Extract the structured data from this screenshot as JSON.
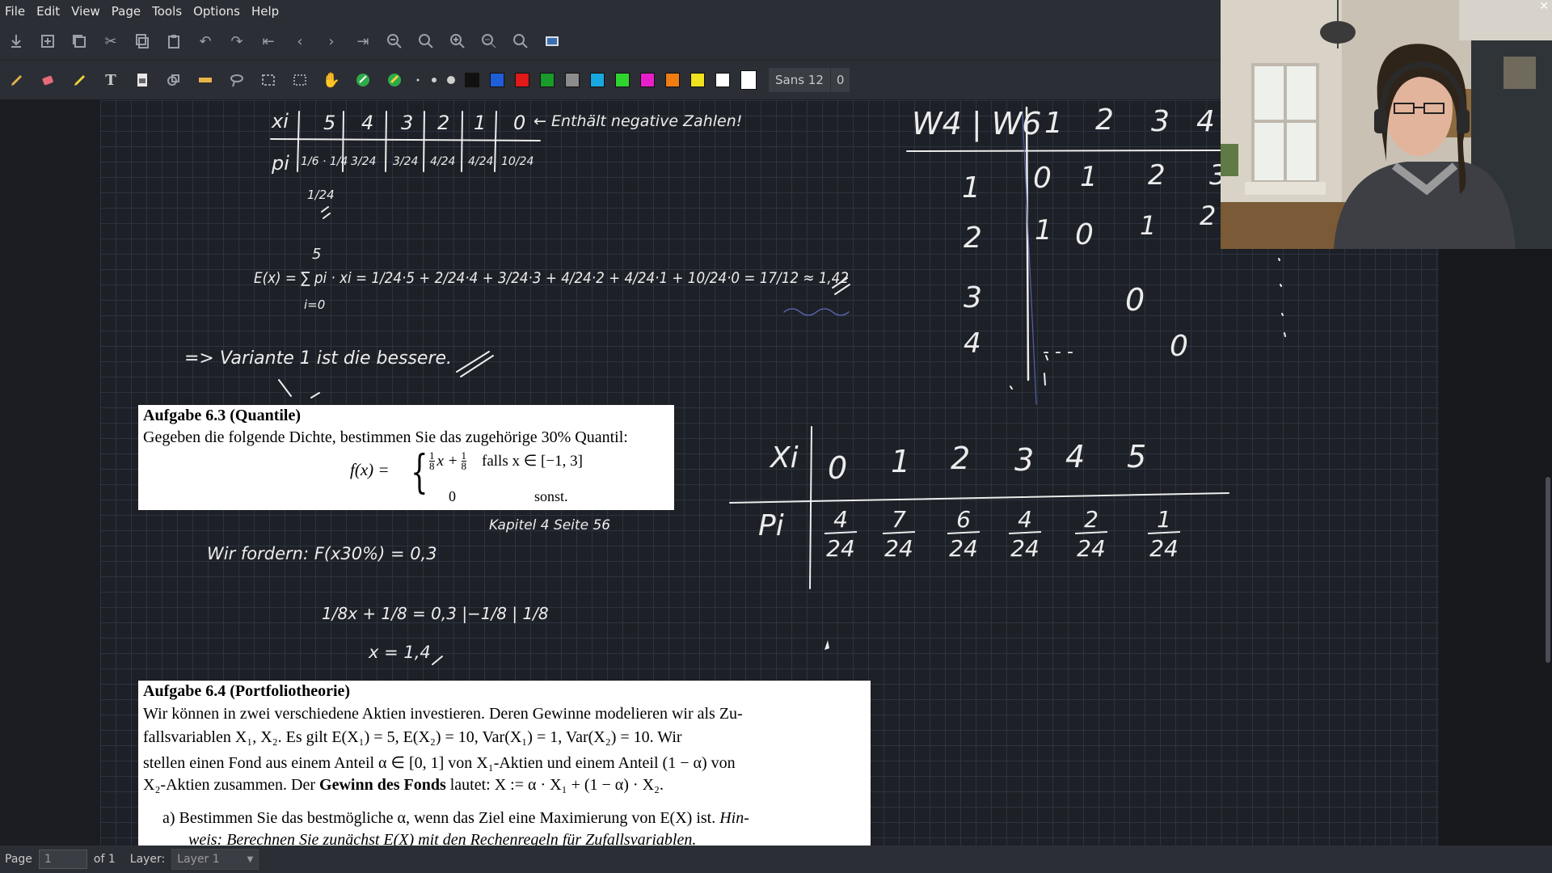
{
  "menu": [
    "File",
    "Edit",
    "View",
    "Page",
    "Tools",
    "Options",
    "Help"
  ],
  "toolbar2": {
    "font_name": "Sans 12",
    "font_size": "0"
  },
  "colors": [
    "#111111",
    "#1e5ed8",
    "#e01919",
    "#1a9a2a",
    "#8c8c8c",
    "#18a8e0",
    "#2fd42f",
    "#e81ecb",
    "#f07c14",
    "#f0e21e",
    "#ffffff"
  ],
  "notes": {
    "table1_header": "xi",
    "table1_x": [
      "5",
      "4",
      "3",
      "2",
      "1",
      "0"
    ],
    "negative_note": "← Enthält negative Zahlen!",
    "table1_p_label": "pi",
    "table1_p": [
      "1/6 · 1/4",
      "3/24",
      "3/24",
      "4/24",
      "4/24",
      "10/24"
    ],
    "p5_result": "1/24",
    "expectation": "E(x) = ∑ pi · xi = 1/24·5 + 2/24·4 + 3/24·3 + 4/24·2 + 4/24·1 + 10/24·0 = 17/12 ≈ 1,42",
    "sum_upper": "5",
    "sum_lower": "i=0",
    "conclusion": "=> Variante 1 ist die bessere.",
    "kapitel": "Kapitel 4 Seite 56",
    "requirement": "Wir fordern: F(x30%) = 0,3",
    "equation": "1/8x + 1/8 = 0,3    |−1/8 | 1/8",
    "result": "x = 1,4"
  },
  "w_table": {
    "header": "W4 | W6",
    "cols": [
      "1",
      "2",
      "3",
      "4"
    ],
    "rows": [
      {
        "label": "1",
        "cells": [
          "0",
          "1",
          "2",
          "3"
        ]
      },
      {
        "label": "2",
        "cells": [
          "1",
          "0",
          "1",
          "2"
        ]
      },
      {
        "label": "3",
        "cells": [
          "",
          "",
          "0",
          ""
        ]
      },
      {
        "label": "4",
        "cells": [
          "",
          "",
          "",
          "0"
        ]
      }
    ]
  },
  "xp_table": {
    "x_label": "Xi",
    "p_label": "Pi",
    "x": [
      "0",
      "1",
      "2",
      "3",
      "4",
      "5"
    ],
    "p_num": [
      "4",
      "7",
      "6",
      "4",
      "2",
      "1"
    ],
    "p_den": [
      "24",
      "24",
      "24",
      "24",
      "24",
      "24"
    ]
  },
  "box1": {
    "title": "Aufgabe 6.3 (Quantile)",
    "text": "Gegeben die folgende Dichte, bestimmen Sie das zugehörige 30% Quantil:",
    "fx": "f(x) =",
    "case1_expr": "x +",
    "case1_cond": "falls x ∈ [−1, 3]",
    "case2_expr": "0",
    "case2_cond": "sonst."
  },
  "box2": {
    "title": "Aufgabe 6.4 (Portfoliotheorie)",
    "line1": "Wir können in zwei verschiedene Aktien investieren.  Deren Gewinne modelieren wir als Zu-",
    "line2": "fallsvariablen X₁, X₂. Es gilt E(X₁) = 5, E(X₂) = 10, Var(X₁) = 1, Var(X₂) = 10. Wir",
    "line3": "stellen einen Fond aus einem Anteil α ∈ [0, 1] von X₁-Aktien und einem Anteil (1 − α) von",
    "line4_a": "X₂-Aktien zusammen. Der ",
    "line4_b": "Gewinn des Fonds",
    "line4_c": " lautet: X := α · X₁ + (1 − α) · X₂.",
    "line5": "a)  Bestimmen Sie das bestmögliche α, wenn das Ziel eine Maximierung von E(X) ist.",
    "line5_hint": "Hin-",
    "line6": "weis: Berechnen Sie zunächst E(X) mit den Rechenregeln für Zufallsvariablen."
  },
  "status": {
    "page_label": "Page",
    "page_value": "1",
    "of_label": "of 1",
    "layer_label": "Layer:",
    "layer_value": "Layer 1"
  }
}
